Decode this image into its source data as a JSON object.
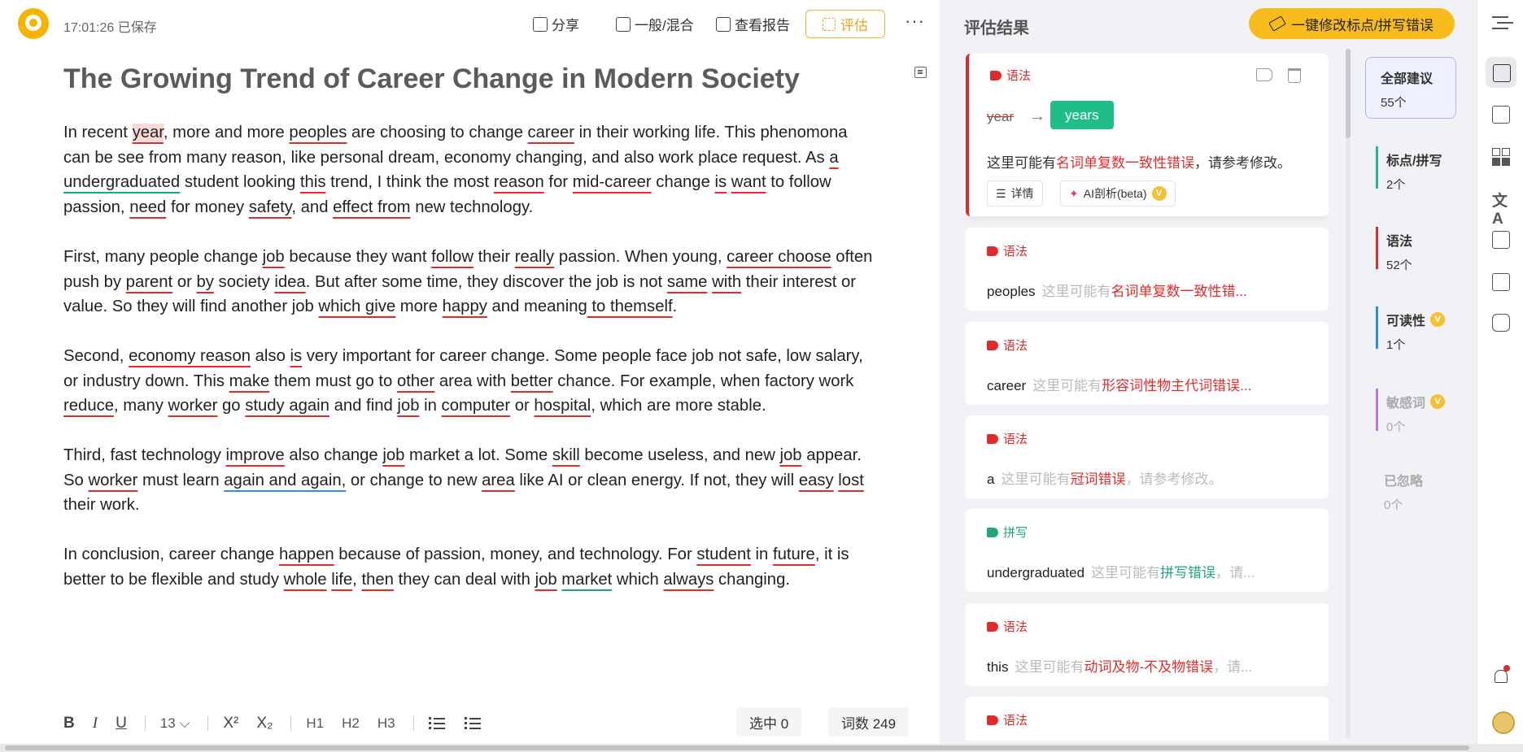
{
  "topbar": {
    "save_status": "17:01:26 已保存",
    "share": "分享",
    "mode": "一般/混合",
    "report": "查看报告",
    "evaluate": "评估",
    "more": "···"
  },
  "document": {
    "title": "The Growing Trend of Career Change in Modern Society"
  },
  "bottom_bar": {
    "bold": "B",
    "italic": "I",
    "underline": "U",
    "font_size": "13",
    "superscript": "X²",
    "subscript": "X₂",
    "h1": "H1",
    "h2": "H2",
    "h3": "H3",
    "selected": "选中 0",
    "word_count": "词数 249"
  },
  "results": {
    "title": "评估结果",
    "fix_all": "一键修改标点/拼写错误",
    "active_card": {
      "tag": "语法",
      "original": "year",
      "suggestion": "years",
      "desc_prefix": "这里可能有",
      "desc_error": "名词单复数一致性错误",
      "desc_suffix": "，请参考修改。",
      "detail": "详情",
      "ai": "AI剖析(beta)"
    },
    "cards": [
      {
        "tag": "语法",
        "type": "grammar",
        "word": "peoples",
        "hint_prefix": "这里可能有",
        "hint_error": "名词单复数一致性错...",
        "hint_suffix": ""
      },
      {
        "tag": "语法",
        "type": "grammar",
        "word": "career",
        "hint_prefix": "这里可能有",
        "hint_error": "形容词性物主代词错误...",
        "hint_suffix": ""
      },
      {
        "tag": "语法",
        "type": "grammar",
        "word": "a",
        "hint_prefix": "这里可能有",
        "hint_error": "冠词错误",
        "hint_suffix": "，请参考修改。"
      },
      {
        "tag": "拼写",
        "type": "spell",
        "word": "undergraduated",
        "hint_prefix": "这里可能有",
        "hint_error": "拼写错误",
        "hint_suffix": "，请..."
      },
      {
        "tag": "语法",
        "type": "grammar",
        "word": "this",
        "hint_prefix": "这里可能有",
        "hint_error": "动词及物-不及物错误",
        "hint_suffix": "，请..."
      },
      {
        "tag": "语法",
        "type": "grammar",
        "word": "",
        "hint_prefix": "",
        "hint_error": "",
        "hint_suffix": ""
      }
    ],
    "filters": {
      "all": {
        "label": "全部建议",
        "count": "55个"
      },
      "punct": {
        "label": "标点/拼写",
        "count": "2个"
      },
      "grammar": {
        "label": "语法",
        "count": "52个"
      },
      "readability": {
        "label": "可读性",
        "count": "1个"
      },
      "sensitive": {
        "label": "敏感词",
        "count": "0个"
      },
      "ignored": {
        "label": "已忽略",
        "count": "0个"
      }
    },
    "vip_mark": "V"
  },
  "rail": {
    "translate_glyph": "文A"
  },
  "colors": {
    "accent": "#f7bc1c",
    "error_red": "#e12b2b",
    "spell_green": "#1fa67d",
    "readability_blue": "#2a8cec",
    "sensitive_purple": "#c170e8",
    "fix_green": "#1fbd8a"
  }
}
